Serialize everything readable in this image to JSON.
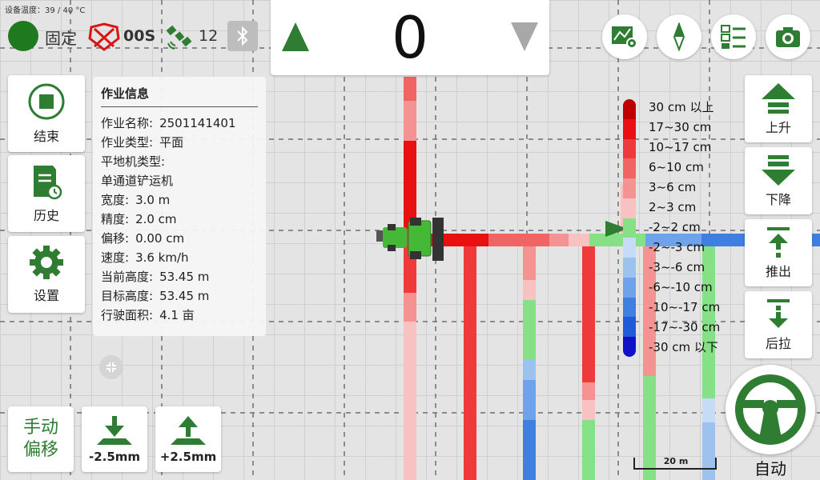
{
  "device_temp": "设备温度：39 / 40 °C",
  "status": {
    "fix_label": "固定",
    "age_label": "00S",
    "satellites": "12"
  },
  "height_delta": "0",
  "left_panel": {
    "end_label": "结束",
    "history_label": "历史",
    "settings_label": "设置"
  },
  "info": {
    "title": "作业信息",
    "name_label": "作业名称:",
    "name": "2501141401",
    "type_label": "作业类型:",
    "type": "平面",
    "leveler_label": "平地机类型:",
    "leveler": "单通道铲运机",
    "width_label": "宽度:",
    "width": "3.0 m",
    "precision_label": "精度:",
    "precision": "2.0 cm",
    "offset_label": "偏移:",
    "offset": "0.00 cm",
    "speed_label": "速度:",
    "speed": "3.6 km/h",
    "current_height_label": "当前高度:",
    "current_height": "53.45 m",
    "target_height_label": "目标高度:",
    "target_height": "53.45 m",
    "area_label": "行驶面积:",
    "area": "4.1 亩"
  },
  "legend": [
    {
      "label": "30 cm 以上",
      "color": "#c00000"
    },
    {
      "label": "17~30 cm",
      "color": "#e81010"
    },
    {
      "label": "10~17 cm",
      "color": "#f03a3a"
    },
    {
      "label": "6~10 cm",
      "color": "#f06464"
    },
    {
      "label": "3~6 cm",
      "color": "#f59292"
    },
    {
      "label": "2~3 cm",
      "color": "#f8c2c2"
    },
    {
      "label": "-2~2 cm",
      "color": "#86e086"
    },
    {
      "label": "-2~-3 cm",
      "color": "#c6dcf6"
    },
    {
      "label": "-3~-6 cm",
      "color": "#9cc2f0"
    },
    {
      "label": "-6~-10 cm",
      "color": "#6ea2ea"
    },
    {
      "label": "-10~-17 cm",
      "color": "#3f7fe0"
    },
    {
      "label": "-17~-30 cm",
      "color": "#1f5ad8"
    },
    {
      "label": "-30 cm 以下",
      "color": "#1010c8"
    }
  ],
  "right_panel": {
    "up_label": "上升",
    "down_label": "下降",
    "push_label": "推出",
    "pull_label": "后拉"
  },
  "manual_offset_label": "手动\n偏移",
  "offset_minus_label": "-2.5mm",
  "offset_plus_label": "+2.5mm",
  "scale_label": "20 m",
  "auto_label": "自动",
  "colors": {
    "primary_green": "#2e7d32",
    "fix_green": "#1f7a1f"
  }
}
